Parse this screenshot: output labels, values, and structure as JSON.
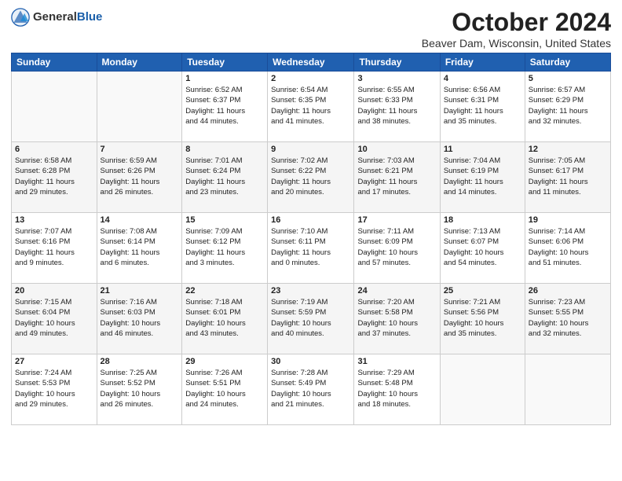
{
  "header": {
    "logo_general": "General",
    "logo_blue": "Blue",
    "title": "October 2024",
    "location": "Beaver Dam, Wisconsin, United States"
  },
  "days_of_week": [
    "Sunday",
    "Monday",
    "Tuesday",
    "Wednesday",
    "Thursday",
    "Friday",
    "Saturday"
  ],
  "weeks": [
    [
      {
        "day": "",
        "content": ""
      },
      {
        "day": "",
        "content": ""
      },
      {
        "day": "1",
        "content": "Sunrise: 6:52 AM\nSunset: 6:37 PM\nDaylight: 11 hours\nand 44 minutes."
      },
      {
        "day": "2",
        "content": "Sunrise: 6:54 AM\nSunset: 6:35 PM\nDaylight: 11 hours\nand 41 minutes."
      },
      {
        "day": "3",
        "content": "Sunrise: 6:55 AM\nSunset: 6:33 PM\nDaylight: 11 hours\nand 38 minutes."
      },
      {
        "day": "4",
        "content": "Sunrise: 6:56 AM\nSunset: 6:31 PM\nDaylight: 11 hours\nand 35 minutes."
      },
      {
        "day": "5",
        "content": "Sunrise: 6:57 AM\nSunset: 6:29 PM\nDaylight: 11 hours\nand 32 minutes."
      }
    ],
    [
      {
        "day": "6",
        "content": "Sunrise: 6:58 AM\nSunset: 6:28 PM\nDaylight: 11 hours\nand 29 minutes."
      },
      {
        "day": "7",
        "content": "Sunrise: 6:59 AM\nSunset: 6:26 PM\nDaylight: 11 hours\nand 26 minutes."
      },
      {
        "day": "8",
        "content": "Sunrise: 7:01 AM\nSunset: 6:24 PM\nDaylight: 11 hours\nand 23 minutes."
      },
      {
        "day": "9",
        "content": "Sunrise: 7:02 AM\nSunset: 6:22 PM\nDaylight: 11 hours\nand 20 minutes."
      },
      {
        "day": "10",
        "content": "Sunrise: 7:03 AM\nSunset: 6:21 PM\nDaylight: 11 hours\nand 17 minutes."
      },
      {
        "day": "11",
        "content": "Sunrise: 7:04 AM\nSunset: 6:19 PM\nDaylight: 11 hours\nand 14 minutes."
      },
      {
        "day": "12",
        "content": "Sunrise: 7:05 AM\nSunset: 6:17 PM\nDaylight: 11 hours\nand 11 minutes."
      }
    ],
    [
      {
        "day": "13",
        "content": "Sunrise: 7:07 AM\nSunset: 6:16 PM\nDaylight: 11 hours\nand 9 minutes."
      },
      {
        "day": "14",
        "content": "Sunrise: 7:08 AM\nSunset: 6:14 PM\nDaylight: 11 hours\nand 6 minutes."
      },
      {
        "day": "15",
        "content": "Sunrise: 7:09 AM\nSunset: 6:12 PM\nDaylight: 11 hours\nand 3 minutes."
      },
      {
        "day": "16",
        "content": "Sunrise: 7:10 AM\nSunset: 6:11 PM\nDaylight: 11 hours\nand 0 minutes."
      },
      {
        "day": "17",
        "content": "Sunrise: 7:11 AM\nSunset: 6:09 PM\nDaylight: 10 hours\nand 57 minutes."
      },
      {
        "day": "18",
        "content": "Sunrise: 7:13 AM\nSunset: 6:07 PM\nDaylight: 10 hours\nand 54 minutes."
      },
      {
        "day": "19",
        "content": "Sunrise: 7:14 AM\nSunset: 6:06 PM\nDaylight: 10 hours\nand 51 minutes."
      }
    ],
    [
      {
        "day": "20",
        "content": "Sunrise: 7:15 AM\nSunset: 6:04 PM\nDaylight: 10 hours\nand 49 minutes."
      },
      {
        "day": "21",
        "content": "Sunrise: 7:16 AM\nSunset: 6:03 PM\nDaylight: 10 hours\nand 46 minutes."
      },
      {
        "day": "22",
        "content": "Sunrise: 7:18 AM\nSunset: 6:01 PM\nDaylight: 10 hours\nand 43 minutes."
      },
      {
        "day": "23",
        "content": "Sunrise: 7:19 AM\nSunset: 5:59 PM\nDaylight: 10 hours\nand 40 minutes."
      },
      {
        "day": "24",
        "content": "Sunrise: 7:20 AM\nSunset: 5:58 PM\nDaylight: 10 hours\nand 37 minutes."
      },
      {
        "day": "25",
        "content": "Sunrise: 7:21 AM\nSunset: 5:56 PM\nDaylight: 10 hours\nand 35 minutes."
      },
      {
        "day": "26",
        "content": "Sunrise: 7:23 AM\nSunset: 5:55 PM\nDaylight: 10 hours\nand 32 minutes."
      }
    ],
    [
      {
        "day": "27",
        "content": "Sunrise: 7:24 AM\nSunset: 5:53 PM\nDaylight: 10 hours\nand 29 minutes."
      },
      {
        "day": "28",
        "content": "Sunrise: 7:25 AM\nSunset: 5:52 PM\nDaylight: 10 hours\nand 26 minutes."
      },
      {
        "day": "29",
        "content": "Sunrise: 7:26 AM\nSunset: 5:51 PM\nDaylight: 10 hours\nand 24 minutes."
      },
      {
        "day": "30",
        "content": "Sunrise: 7:28 AM\nSunset: 5:49 PM\nDaylight: 10 hours\nand 21 minutes."
      },
      {
        "day": "31",
        "content": "Sunrise: 7:29 AM\nSunset: 5:48 PM\nDaylight: 10 hours\nand 18 minutes."
      },
      {
        "day": "",
        "content": ""
      },
      {
        "day": "",
        "content": ""
      }
    ]
  ]
}
